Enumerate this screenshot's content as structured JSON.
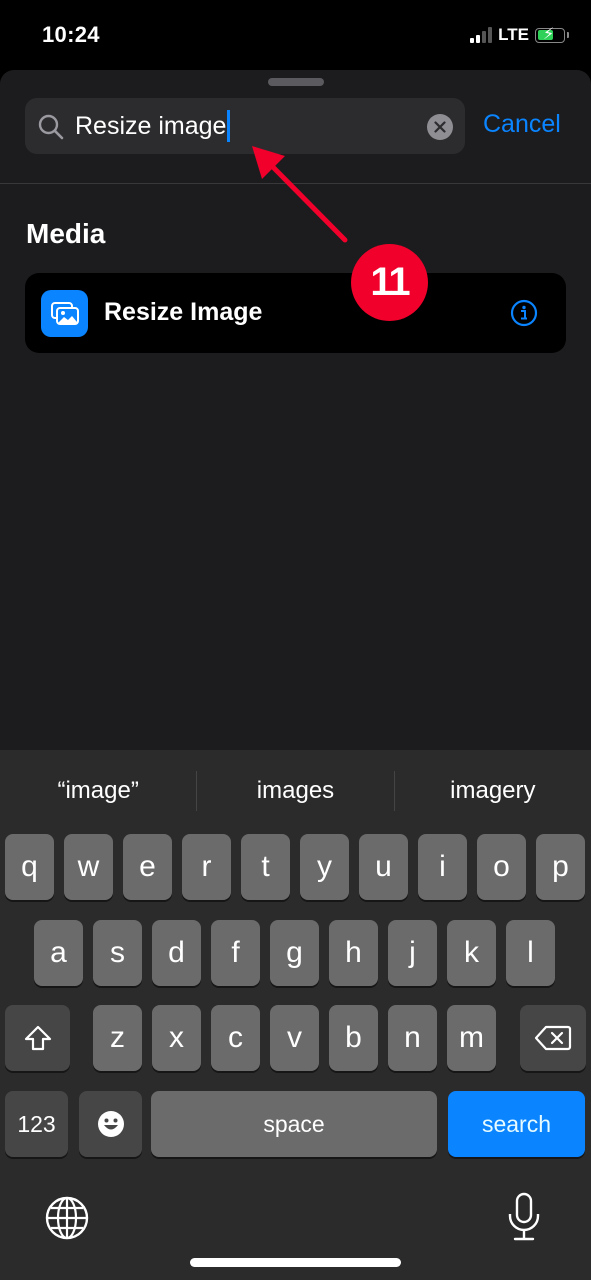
{
  "status_bar": {
    "time": "10:24",
    "network": "LTE",
    "signal_bars_active": 2,
    "signal_bars_total": 4,
    "battery_charging": true
  },
  "search": {
    "value": "Resize image",
    "cancel_label": "Cancel",
    "icon": "search-icon",
    "clear_icon": "clear-icon"
  },
  "results": {
    "section_title": "Media",
    "items": [
      {
        "label": "Resize Image",
        "icon": "photos-icon",
        "accessory_icon": "info-icon"
      }
    ]
  },
  "annotation": {
    "step_number": "11",
    "color": "#f0002a"
  },
  "keyboard": {
    "suggestions": [
      "“image”",
      "images",
      "imagery"
    ],
    "row1": [
      "q",
      "w",
      "e",
      "r",
      "t",
      "y",
      "u",
      "i",
      "o",
      "p"
    ],
    "row2": [
      "a",
      "s",
      "d",
      "f",
      "g",
      "h",
      "j",
      "k",
      "l"
    ],
    "row3": [
      "z",
      "x",
      "c",
      "v",
      "b",
      "n",
      "m"
    ],
    "numbers_label": "123",
    "space_label": "space",
    "return_label": "search",
    "accent_color": "#0a84ff"
  }
}
